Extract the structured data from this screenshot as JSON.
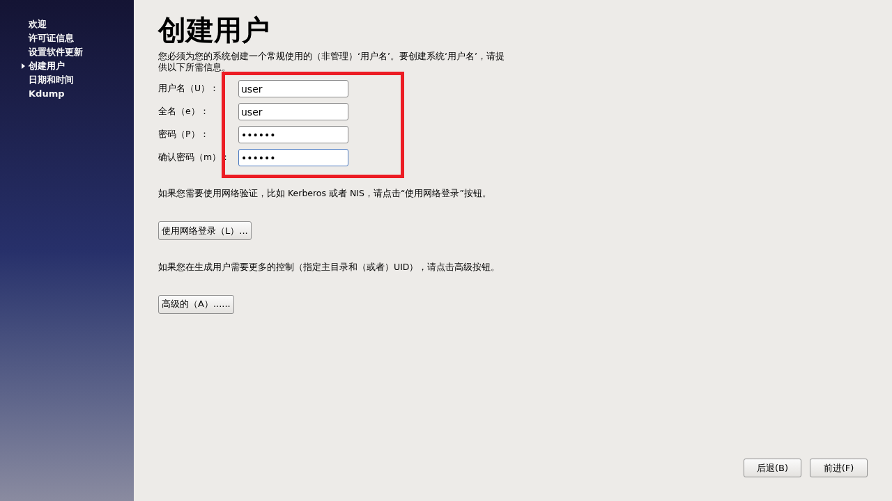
{
  "sidebar": {
    "items": [
      {
        "label": "欢迎",
        "selected": false
      },
      {
        "label": "许可证信息",
        "selected": false
      },
      {
        "label": "设置软件更新",
        "selected": false
      },
      {
        "label": "创建用户",
        "selected": true
      },
      {
        "label": "日期和时间",
        "selected": false
      },
      {
        "label": "Kdump",
        "selected": false
      }
    ]
  },
  "title": "创建用户",
  "description": "您必须为您的系统创建一个常规使用的（非管理）‘用户名’。要创建系统‘用户名’，请提供以下所需信息。",
  "form": {
    "highlighted": true,
    "fields": [
      {
        "label": "用户名（U）：",
        "value": "user",
        "focused": false
      },
      {
        "label": "全名（e）：",
        "value": "user",
        "focused": false
      },
      {
        "label": "密码（P）：",
        "value": "••••••",
        "focused": false
      },
      {
        "label": "确认密码（m）：",
        "value": "••••••",
        "focused": true
      }
    ]
  },
  "network_note": "如果您需要使用网络验证，比如 Kerberos 或者 NIS，请点击“使用网络登录”按钮。",
  "network_button": "使用网络登录（L）...",
  "advanced_note": "如果您在生成用户需要更多的控制（指定主目录和（或者）UID），请点击高级按钮。",
  "advanced_button": "高级的（A）......",
  "nav_buttons": [
    "后退(B)",
    "前进(F)"
  ]
}
